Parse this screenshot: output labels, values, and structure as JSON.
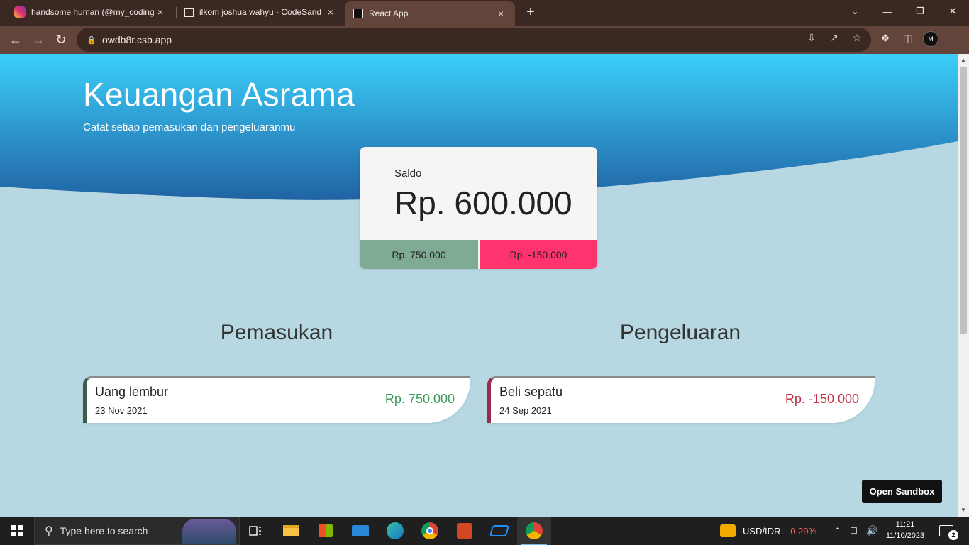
{
  "browser": {
    "tabs": [
      {
        "title": "handsome human (@my_coding",
        "close": "×"
      },
      {
        "title": "ilkom joshua wahyu - CodeSand",
        "close": "×"
      },
      {
        "title": "React App",
        "close": "×"
      }
    ],
    "new_tab": "+",
    "window_controls": {
      "dropdown": "⌄",
      "minimize": "—",
      "restore": "❐",
      "close": "✕"
    },
    "url": "owdb8r.csb.app"
  },
  "page": {
    "title": "Keuangan Asrama",
    "subtitle": "Catat setiap pemasukan dan pengeluaranmu",
    "balance": {
      "label": "Saldo",
      "value": "Rp. 600.000",
      "income_total": "Rp. 750.000",
      "expense_total": "Rp. -150.000"
    },
    "income": {
      "heading": "Pemasukan",
      "items": [
        {
          "name": "Uang lembur",
          "date": "23 Nov 2021",
          "amount": "Rp. 750.000"
        }
      ]
    },
    "expense": {
      "heading": "Pengeluaran",
      "items": [
        {
          "name": "Beli sepatu",
          "date": "24 Sep 2021",
          "amount": "Rp. -150.000"
        }
      ]
    },
    "open_sandbox": "Open Sandbox"
  },
  "taskbar": {
    "search_placeholder": "Type here to search",
    "ticker": {
      "label": "USD/IDR",
      "change": "-0.29%"
    },
    "clock": {
      "time": "11:21",
      "date": "11/10/2023"
    },
    "notifications": "2",
    "profile_initial": "M"
  },
  "colors": {
    "hero_top": "#3ccffb",
    "hero_bottom": "#2063a3",
    "page_bg": "#b7d8e3",
    "income_green": "#7fab94",
    "expense_pink": "#ff336e"
  }
}
